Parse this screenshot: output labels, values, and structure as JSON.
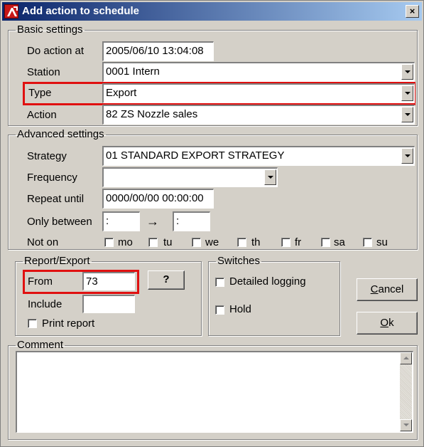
{
  "window": {
    "title": "Add action to schedule",
    "close_glyph": "×"
  },
  "basic": {
    "legend": "Basic settings",
    "do_action_label": "Do action at",
    "do_action_value": "2005/06/10 13:04:08",
    "station_label": "Station",
    "station_value": "0001  Intern",
    "type_label": "Type",
    "type_value": "Export",
    "action_label": "Action",
    "action_value": "82  ZS Nozzle sales"
  },
  "advanced": {
    "legend": "Advanced settings",
    "strategy_label": "Strategy",
    "strategy_value": "01  STANDARD EXPORT STRATEGY",
    "frequency_label": "Frequency",
    "frequency_value": "",
    "repeat_label": "Repeat until",
    "repeat_value": "0000/00/00  00:00:00",
    "between_label": "Only between",
    "between_from": ":",
    "between_arrow": "→",
    "between_to": ":",
    "noton_label": "Not on",
    "days": [
      "mo",
      "tu",
      "we",
      "th",
      "fr",
      "sa",
      "su"
    ]
  },
  "report": {
    "legend": "Report/Export",
    "from_label": "From",
    "from_value": "73",
    "query_button": "?",
    "include_label": "Include",
    "include_value": "",
    "print_label": "Print report"
  },
  "switches": {
    "legend": "Switches",
    "logging_label": "Detailed logging",
    "hold_label": "Hold"
  },
  "buttons": {
    "cancel_acc": "C",
    "cancel_rest": "ancel",
    "ok_acc": "O",
    "ok_rest": "k"
  },
  "comment": {
    "legend": "Comment",
    "value": ""
  },
  "colors": {
    "highlight": "#e01010",
    "titlebar": "#0a246a",
    "face": "#d4d0c8"
  },
  "icons": [
    "app-icon",
    "close-icon",
    "chevron-down-icon",
    "scroll-up-icon",
    "scroll-down-icon"
  ]
}
